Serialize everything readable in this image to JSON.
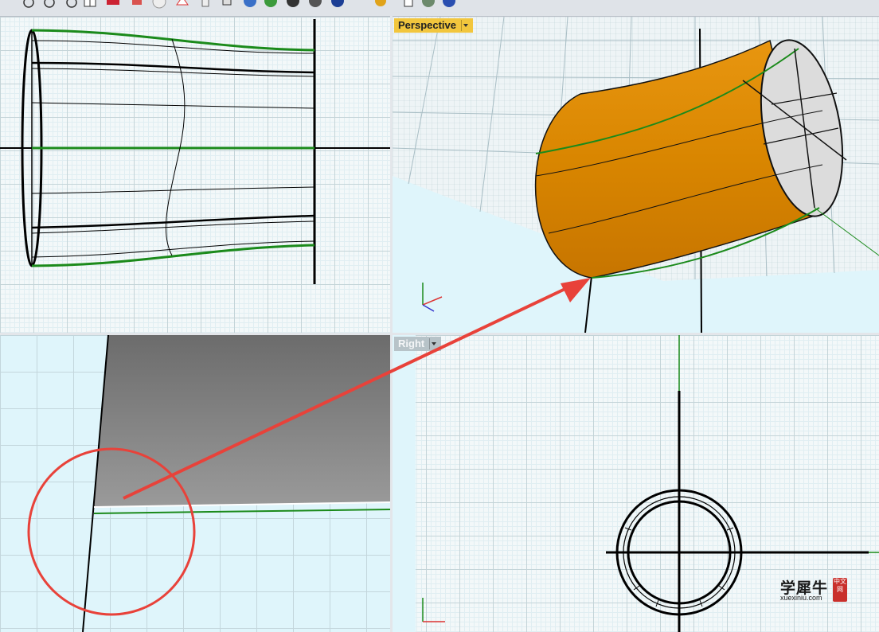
{
  "toolbar": {
    "icons": [
      "zoom-window-icon",
      "zoom-extents-icon",
      "zoom-selected-icon",
      "four-viewports-icon",
      "properties-icon",
      "layer-icon",
      "sphere-outline-icon",
      "point-icon",
      "light-bulb-icon",
      "box-icon",
      "shaded-sphere-icon",
      "rendered-sphere-icon",
      "dark-sphere-icon",
      "gray-sphere-icon",
      "blue-sphere-icon",
      "gear-icon",
      "arrow-tool-icon",
      "globe-icon",
      "help-icon"
    ]
  },
  "viewports": {
    "perspective": {
      "label": "Perspective",
      "active": true
    },
    "right": {
      "label": "Right",
      "active": false
    }
  },
  "colors": {
    "curve_green": "#1b8a1b",
    "surface_orange": "#e28b05",
    "tab_active": "#f2c63d",
    "annotation_red": "#e8423a",
    "viewport_bg": "#dff5fb"
  },
  "watermark": {
    "main": "学犀牛",
    "sub": "xuexiniu.com",
    "seal": "中文网"
  }
}
